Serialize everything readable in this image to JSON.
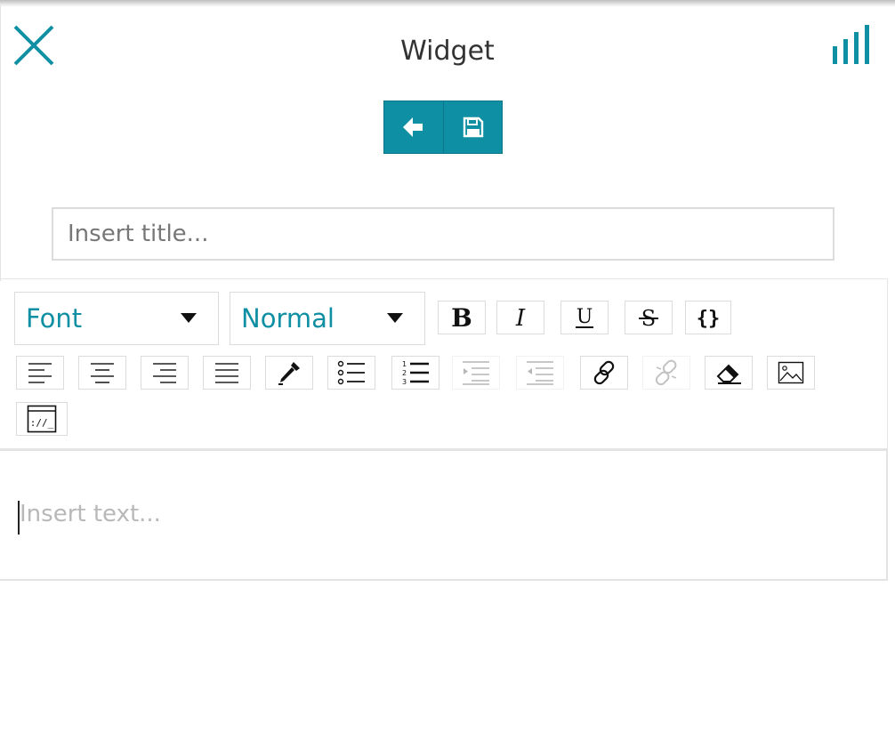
{
  "header": {
    "title": "Widget",
    "close_icon": "close-icon",
    "stats_icon": "bar-chart-icon",
    "accent_color": "#0f8fa3"
  },
  "actions": {
    "back_icon": "arrow-left-icon",
    "save_icon": "floppy-disk-icon"
  },
  "title_field": {
    "placeholder": "Insert title..."
  },
  "toolbar": {
    "font_select": {
      "value": "Font"
    },
    "size_select": {
      "value": "Normal"
    },
    "buttons": [
      {
        "name": "bold",
        "icon": "bold-icon"
      },
      {
        "name": "italic",
        "icon": "italic-icon"
      },
      {
        "name": "underline",
        "icon": "underline-icon"
      },
      {
        "name": "strikethrough",
        "icon": "strikethrough-icon"
      },
      {
        "name": "code",
        "icon": "curly-braces-icon"
      },
      {
        "name": "align-left",
        "icon": "align-left-icon"
      },
      {
        "name": "align-center",
        "icon": "align-center-icon"
      },
      {
        "name": "align-right",
        "icon": "align-right-icon"
      },
      {
        "name": "align-justify",
        "icon": "align-justify-icon"
      },
      {
        "name": "color",
        "icon": "eyedropper-icon"
      },
      {
        "name": "bullet-list",
        "icon": "bullet-list-icon"
      },
      {
        "name": "numbered-list",
        "icon": "numbered-list-icon"
      },
      {
        "name": "indent",
        "icon": "indent-icon",
        "disabled": true
      },
      {
        "name": "outdent",
        "icon": "outdent-icon",
        "disabled": true
      },
      {
        "name": "link",
        "icon": "link-icon"
      },
      {
        "name": "unlink",
        "icon": "unlink-icon",
        "disabled": true
      },
      {
        "name": "clear-format",
        "icon": "eraser-icon"
      },
      {
        "name": "image",
        "icon": "image-icon"
      },
      {
        "name": "embed",
        "icon": "embed-code-icon"
      }
    ]
  },
  "editor": {
    "placeholder": "Insert text..."
  }
}
